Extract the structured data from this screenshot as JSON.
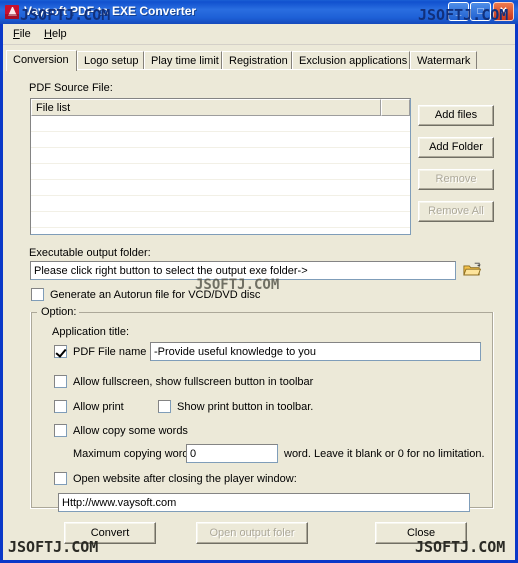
{
  "window": {
    "title": "Vaysoft PDF to EXE Converter",
    "icon": "pdf-document-icon",
    "titlebar_color": "#1f5fcf",
    "body_color": "#ece9d8",
    "controls": {
      "minimize": "_",
      "maximize": "□",
      "close": "✕"
    }
  },
  "menu": {
    "items": [
      {
        "label": "File",
        "accel": "F"
      },
      {
        "label": "Help",
        "accel": "H"
      }
    ]
  },
  "tabs": {
    "active_index": 0,
    "items": [
      {
        "label": "Conversion"
      },
      {
        "label": "Logo setup"
      },
      {
        "label": "Play time limit"
      },
      {
        "label": "Registration"
      },
      {
        "label": "Exclusion applications"
      },
      {
        "label": "Watermark"
      }
    ]
  },
  "conversion": {
    "source_label": "PDF Source File:",
    "file_list": {
      "columns": [
        "File list",
        ""
      ],
      "rows": [],
      "empty_row_count": 8
    },
    "list_buttons": [
      {
        "label": "Add files",
        "enabled": true,
        "name": "add-files-button"
      },
      {
        "label": "Add Folder",
        "enabled": true,
        "name": "add-folder-button"
      },
      {
        "label": "Remove",
        "enabled": false,
        "name": "remove-button"
      },
      {
        "label": "Remove All",
        "enabled": false,
        "name": "remove-all-button"
      }
    ],
    "output_label": "Executable output folder:",
    "output_value": "Please click right button to select the output exe folder->",
    "browse_icon": "open-folder-icon",
    "autorun_checkbox": {
      "label": "Generate an Autorun file for VCD/DVD disc",
      "checked": false
    },
    "option_group": {
      "title": "Option:",
      "app_title_label": "Application title:",
      "pdf_file_name": {
        "label": "PDF File name",
        "checked": true
      },
      "app_title_value": "-Provide useful knowledge to you",
      "allow_fullscreen": {
        "label": "Allow fullscreen, show fullscreen button in toolbar",
        "checked": false
      },
      "allow_print": {
        "label": "Allow print",
        "checked": false
      },
      "show_print_button": {
        "label": "Show print button in toolbar.",
        "checked": false
      },
      "allow_copy": {
        "label": "Allow copy some words",
        "checked": false
      },
      "max_copy_label": "Maximum copying word:",
      "max_copy_value": "0",
      "max_copy_suffix": "word. Leave it blank or 0 for no limitation.",
      "open_website": {
        "label": "Open website after closing the player window:",
        "checked": false
      },
      "website_value": "Http://www.vaysoft.com"
    }
  },
  "footer_buttons": [
    {
      "label": "Convert",
      "enabled": true,
      "name": "convert-button"
    },
    {
      "label": "Open output foler",
      "enabled": false,
      "name": "open-output-folder-button"
    },
    {
      "label": "Close",
      "enabled": true,
      "name": "close-button"
    }
  ],
  "watermarks": {
    "text": "JSOFTJ.COM",
    "title_left": "JSOFTJ.COM",
    "title_right": "JSOFTJ.COM",
    "middle": "JSOFTJ.COM",
    "bottom_left": "JSOFTJ.COM",
    "bottom_right": "JSOFTJ.COM"
  }
}
